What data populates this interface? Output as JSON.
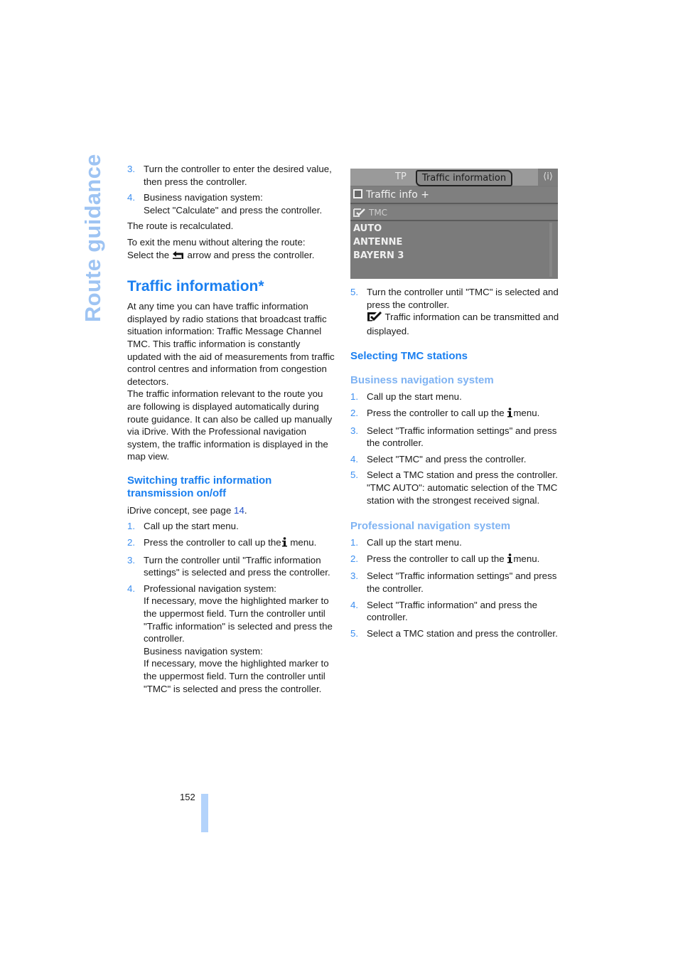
{
  "side_title": "Route guidance",
  "left": {
    "intro_steps": [
      {
        "num": "3.",
        "text": "Turn the controller to enter the desired value, then press the controller."
      },
      {
        "num": "4.",
        "text": "Business navigation system:",
        "text2": "Select \"Calculate\" and press the controller."
      }
    ],
    "recalculated": "The route is recalculated.",
    "exit_line1": "To exit the menu without altering the route:",
    "exit_line2_pre": "Select the",
    "exit_line2_post": "arrow and press the controller.",
    "heading": "Traffic information*",
    "para1": "At any time you can have traffic information displayed by radio stations that broadcast traffic situation information: Traffic Message Channel TMC. This traffic information is constantly updated with the aid of measurements from traffic control centres and information from congestion detectors.",
    "para2": "The traffic information relevant to the route you are following is displayed automatically during route guidance. It can also be called up manually via iDrive. With the Professional navigation system, the traffic information is displayed in the map view.",
    "subheading": "Switching traffic information transmission on/off",
    "idrive_pre": "iDrive concept, see page ",
    "idrive_link": "14",
    "idrive_post": ".",
    "steps": [
      {
        "num": "1.",
        "text": "Call up the start menu."
      },
      {
        "num": "2.",
        "pre": "Press the controller to call up the",
        "post": "menu."
      },
      {
        "num": "3.",
        "text": "Turn the controller until \"Traffic information settings\" is selected and press the controller."
      },
      {
        "num": "4.",
        "lines": [
          "Professional navigation system:",
          "If necessary, move the highlighted marker to the uppermost field. Turn the controller until \"Traffic information\" is selected and press the controller.",
          "Business navigation system:",
          "If necessary, move the highlighted marker to the uppermost field. Turn the controller until \"TMC\" is selected and press the controller."
        ]
      }
    ]
  },
  "screen": {
    "tab_tp": "TP",
    "tab_active": "Traffic information",
    "info_icon": "i",
    "row1": "Traffic info +",
    "row2": "TMC",
    "stations": [
      "AUTO",
      "ANTENNE",
      "BAYERN 3"
    ]
  },
  "right": {
    "step5": {
      "num": "5.",
      "text": "Turn the controller until \"TMC\" is selected and press the controller.",
      "note": "Traffic information can be transmitted and displayed."
    },
    "heading": "Selecting TMC stations",
    "business": {
      "heading": "Business navigation system",
      "steps": [
        {
          "num": "1.",
          "text": "Call up the start menu."
        },
        {
          "num": "2.",
          "pre": "Press the controller to call up the",
          "post": "menu."
        },
        {
          "num": "3.",
          "text": "Select \"Traffic information settings\" and press the controller."
        },
        {
          "num": "4.",
          "text": "Select \"TMC\" and press the controller."
        },
        {
          "num": "5.",
          "text": "Select a TMC station and press the controller.",
          "note": "\"TMC AUTO\": automatic selection of the TMC station with the strongest received signal."
        }
      ]
    },
    "professional": {
      "heading": "Professional navigation system",
      "steps": [
        {
          "num": "1.",
          "text": "Call up the start menu."
        },
        {
          "num": "2.",
          "pre": "Press the controller to call up the",
          "post": "menu."
        },
        {
          "num": "3.",
          "text": "Select \"Traffic information settings\" and press the controller."
        },
        {
          "num": "4.",
          "text": "Select \"Traffic information\" and press the controller."
        },
        {
          "num": "5.",
          "text": "Select a TMC station and press the controller."
        }
      ]
    }
  },
  "page_number": "152"
}
